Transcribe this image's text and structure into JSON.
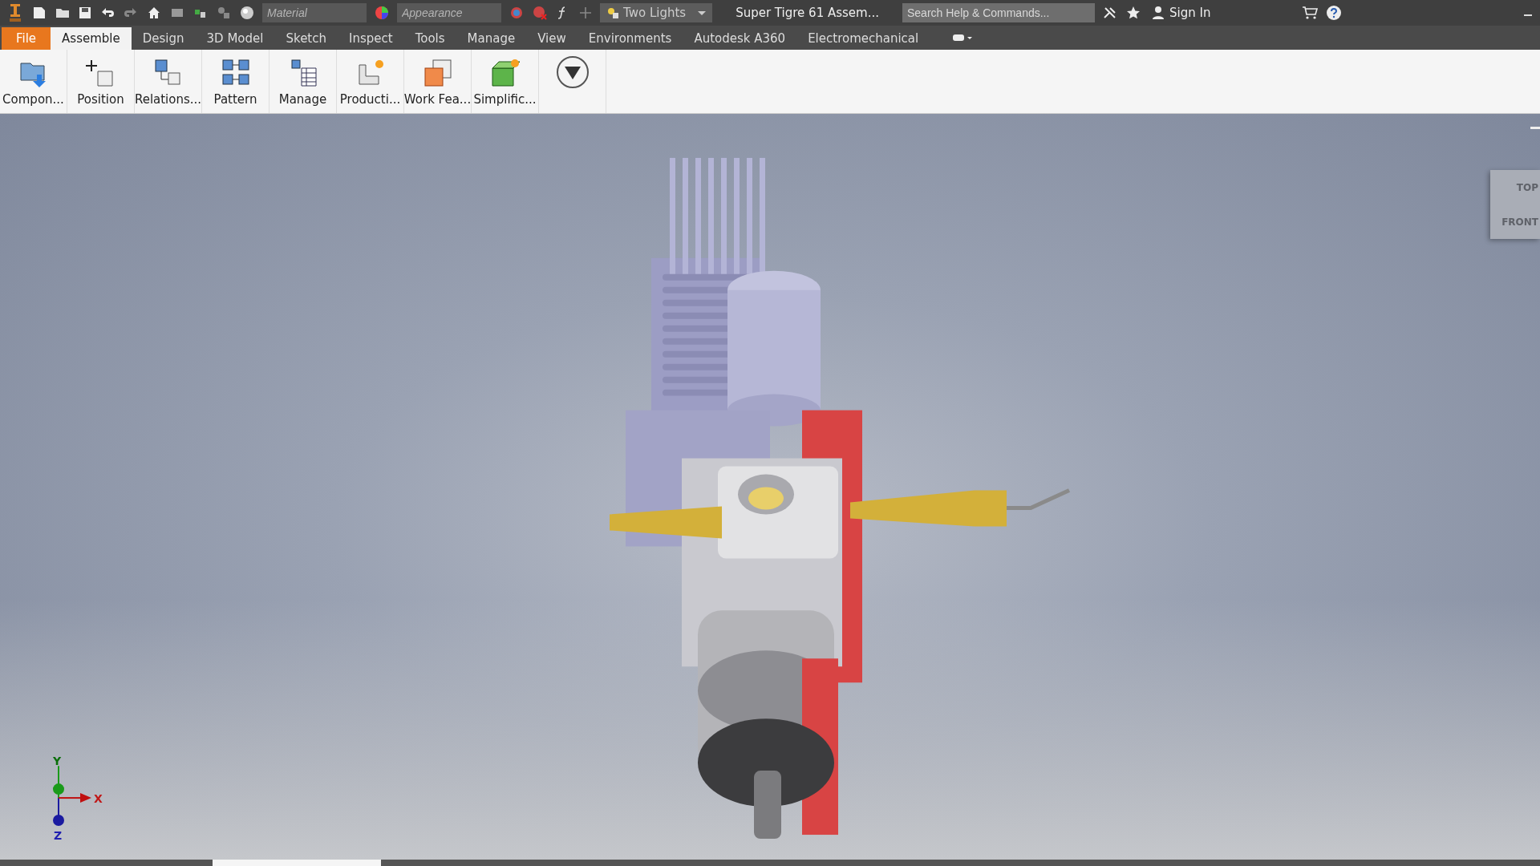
{
  "toolbar": {
    "material_placeholder": "Material",
    "appearance_placeholder": "Appearance",
    "lighting": "Two Lights",
    "document_title": "Super Tigre 61 Assem...",
    "search_placeholder": "Search Help & Commands...",
    "sign_in": "Sign In"
  },
  "tabs": [
    {
      "label": "File",
      "kind": "file",
      "selected": false
    },
    {
      "label": "Assemble",
      "kind": "tab",
      "selected": true
    },
    {
      "label": "Design",
      "kind": "tab",
      "selected": false
    },
    {
      "label": "3D Model",
      "kind": "tab",
      "selected": false
    },
    {
      "label": "Sketch",
      "kind": "tab",
      "selected": false
    },
    {
      "label": "Inspect",
      "kind": "tab",
      "selected": false
    },
    {
      "label": "Tools",
      "kind": "tab",
      "selected": false
    },
    {
      "label": "Manage",
      "kind": "tab",
      "selected": false
    },
    {
      "label": "View",
      "kind": "tab",
      "selected": false
    },
    {
      "label": "Environments",
      "kind": "tab",
      "selected": false
    },
    {
      "label": "Autodesk A360",
      "kind": "tab",
      "selected": false
    },
    {
      "label": "Electromechanical",
      "kind": "tab",
      "selected": false
    }
  ],
  "ribbon": [
    {
      "label": "Compon...",
      "kind": "component"
    },
    {
      "label": "Position",
      "kind": "position"
    },
    {
      "label": "Relations...",
      "kind": "relations"
    },
    {
      "label": "Pattern",
      "kind": "pattern"
    },
    {
      "label": "Manage",
      "kind": "manage"
    },
    {
      "label": "Producti...",
      "kind": "productivity"
    },
    {
      "label": "Work Fea...",
      "kind": "work"
    },
    {
      "label": "Simplific...",
      "kind": "simplify"
    },
    {
      "kind": "more"
    }
  ],
  "viewcube": {
    "top": "TOP",
    "front": "FRONT"
  },
  "axes": {
    "x": "X",
    "y": "Y",
    "z": "Z"
  }
}
